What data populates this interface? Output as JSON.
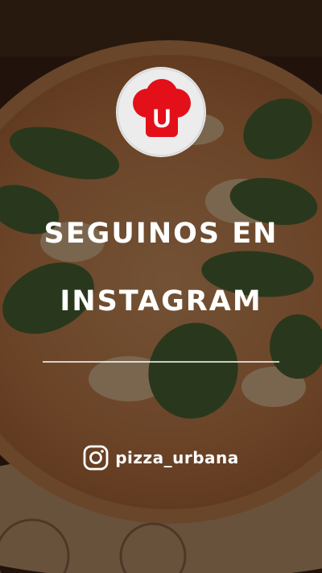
{
  "promo": {
    "title_line1": "SEGUINOS EN",
    "title_line2": "INSTAGRAM",
    "handle": "pizza_urbana"
  },
  "logo": {
    "letter": "U"
  },
  "icons": [
    "instagram-icon",
    "chef-hat-logo"
  ],
  "colors": {
    "brand_red": "#e3101a",
    "text": "#ffffff",
    "basil": "#3d6b33",
    "overlay": "#1a0f0a"
  }
}
